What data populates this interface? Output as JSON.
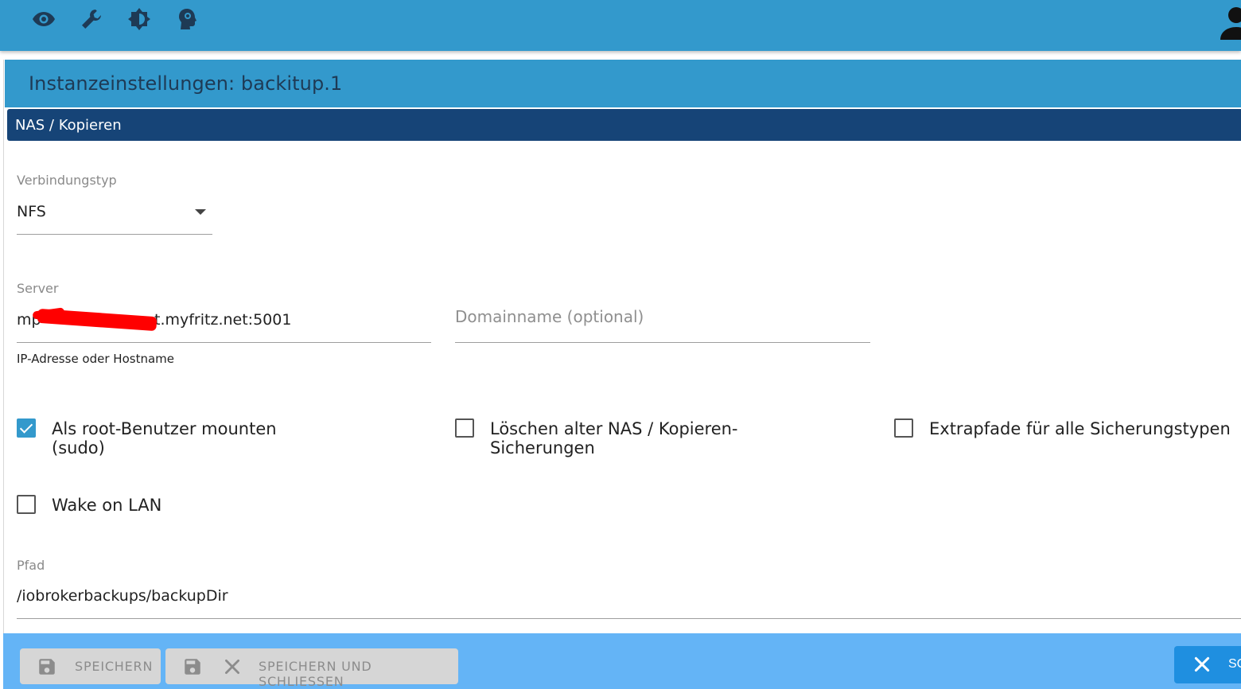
{
  "topbar": {
    "icons": [
      "eye-icon",
      "wrench-icon",
      "brightness-icon",
      "expert-mode-icon"
    ],
    "user_icon": "user-icon",
    "color": "#3399cc"
  },
  "dialog": {
    "title": "Instanzeinstellungen: backitup.1"
  },
  "section": {
    "title": "NAS / Kopieren"
  },
  "connection_type": {
    "label": "Verbindungstyp",
    "value": "NFS"
  },
  "server": {
    "label": "Server",
    "value_prefix": "mp",
    "value_suffix": "t.myfritz.net:5001",
    "helper": "IP-Adresse oder Hostname"
  },
  "domain": {
    "placeholder": "Domainname (optional)"
  },
  "checkboxes": {
    "sudo": {
      "label": "Als root-Benutzer mounten (sudo)",
      "checked": true
    },
    "delete_old": {
      "label": "Löschen alter NAS / Kopieren-Sicherungen",
      "checked": false
    },
    "extra_paths": {
      "label": "Extrapfade für alle Sicherungstypen",
      "checked": false
    },
    "wol": {
      "label": "Wake on LAN",
      "checked": false
    }
  },
  "path": {
    "label": "Pfad",
    "value": "/iobrokerbackups/backupDir"
  },
  "footer": {
    "save_label": "SPEICHERN",
    "save_close_label": "SPEICHERN UND SCHLIESSEN",
    "close_label": "SC"
  }
}
